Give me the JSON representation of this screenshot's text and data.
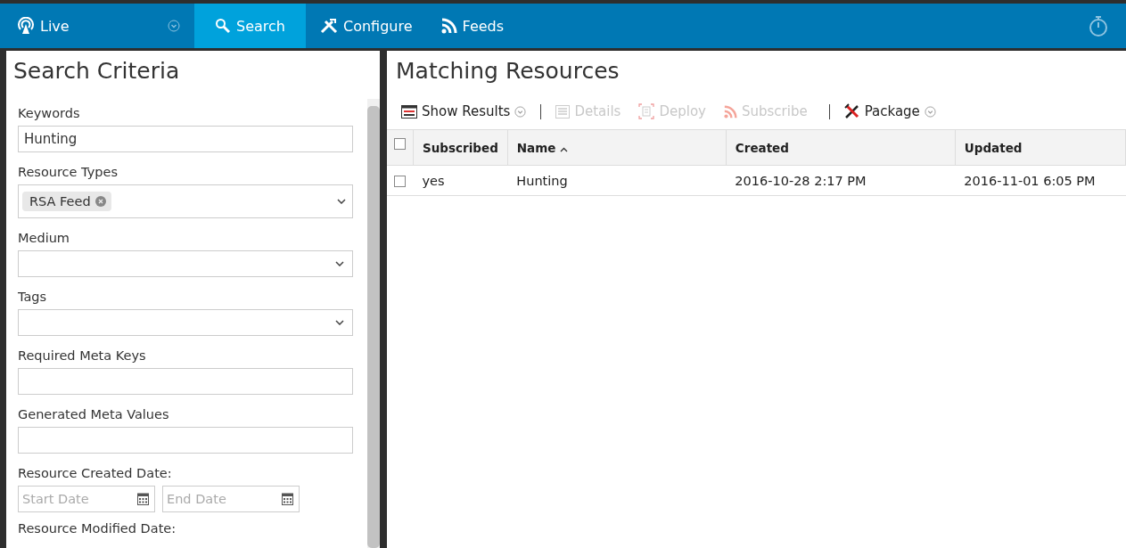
{
  "nav": {
    "items": [
      {
        "label": "Live",
        "kind": "live",
        "selected": false
      },
      {
        "label": "Search",
        "kind": "search",
        "selected": true
      },
      {
        "label": "Configure",
        "kind": "configure",
        "selected": false
      },
      {
        "label": "Feeds",
        "kind": "feeds",
        "selected": false
      }
    ]
  },
  "search_criteria": {
    "title": "Search Criteria",
    "fields": [
      {
        "kind": "text",
        "label": "Keywords",
        "value": "Hunting"
      },
      {
        "kind": "tags",
        "label": "Resource Types",
        "tags": [
          "RSA Feed"
        ]
      },
      {
        "kind": "select",
        "label": "Medium"
      },
      {
        "kind": "select",
        "label": "Tags"
      },
      {
        "kind": "text",
        "label": "Required Meta Keys"
      },
      {
        "kind": "text",
        "label": "Generated Meta Values"
      },
      {
        "kind": "date_range",
        "label": "Resource Created Date:",
        "start_placeholder": "Start Date",
        "end_placeholder": "End Date"
      },
      {
        "kind": "heading",
        "label": "Resource Modified Date:"
      }
    ]
  },
  "results": {
    "title": "Matching Resources",
    "toolbar": [
      {
        "kind": "show_results",
        "label": "Show Results",
        "disabled": false
      },
      {
        "kind": "separator"
      },
      {
        "kind": "details",
        "label": "Details",
        "disabled": true
      },
      {
        "kind": "deploy",
        "label": "Deploy",
        "disabled": true
      },
      {
        "kind": "subscribe",
        "label": "Subscribe",
        "disabled": true
      },
      {
        "kind": "separator"
      },
      {
        "kind": "package",
        "label": "Package",
        "disabled": false
      }
    ],
    "table": {
      "all_checked": false,
      "columns": [
        {
          "label": "Subscribed",
          "sorted": false
        },
        {
          "label": "Name",
          "sorted": true
        },
        {
          "label": "Created",
          "sorted": false
        },
        {
          "label": "Updated",
          "sorted": false
        }
      ],
      "rows": [
        {
          "checked": false,
          "cells": [
            "yes",
            "Hunting",
            "2016-10-28 2:17 PM",
            "2016-11-01 6:05 PM"
          ]
        }
      ]
    }
  }
}
